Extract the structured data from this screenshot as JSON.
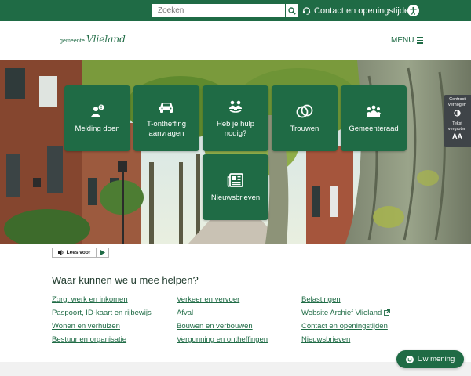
{
  "topbar": {
    "search_placeholder": "Zoeken",
    "contact_label": "Contact en openingstijden"
  },
  "header": {
    "logo_small": "gemeente",
    "logo_script": "Vlieland",
    "menu_label": "MENU"
  },
  "tiles": [
    {
      "label": "Melding doen",
      "icon": "alert-person-icon"
    },
    {
      "label": "T-ontheffing aanvragen",
      "icon": "car-icon"
    },
    {
      "label": "Heb je hulp nodig?",
      "icon": "help-people-icon"
    },
    {
      "label": "Trouwen",
      "icon": "rings-icon"
    },
    {
      "label": "Gemeenteraad",
      "icon": "council-icon"
    },
    {
      "label": "Nieuwsbrieven",
      "icon": "newspaper-icon"
    }
  ],
  "sidepanel": {
    "contrast_label": "Contrast verhogen",
    "text_label": "Tekst vergroten",
    "text_glyph": "AA"
  },
  "leesvoor_label": "Lees voor",
  "section_title": "Waar kunnen we u mee helpen?",
  "links": {
    "col1": [
      "Zorg, werk en inkomen",
      "Paspoort, ID-kaart en rijbewijs",
      "Wonen en verhuizen",
      "Bestuur en organisatie"
    ],
    "col2": [
      "Verkeer en vervoer",
      "Afval",
      "Bouwen en verbouwen",
      "Vergunning en ontheffingen"
    ],
    "col3": [
      "Belastingen",
      "Website Archief Vlieland",
      "Contact en openingstijden",
      "Nieuwsbrieven"
    ]
  },
  "feedback_label": "Uw mening",
  "colors": {
    "brand_green": "#1f6b45",
    "panel_grey": "#3f4448"
  }
}
